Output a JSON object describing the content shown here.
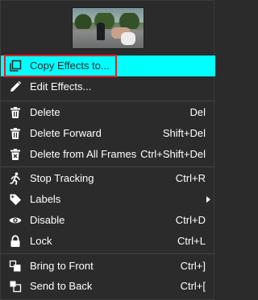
{
  "menu": {
    "items": {
      "copy_effects": {
        "label": "Copy Effects to...",
        "icon": "copy-icon"
      },
      "edit_effects": {
        "label": "Edit Effects...",
        "icon": "pencil-icon"
      },
      "delete": {
        "label": "Delete",
        "shortcut": "Del",
        "icon": "trash-icon"
      },
      "delete_forward": {
        "label": "Delete Forward",
        "shortcut": "Shift+Del",
        "icon": "trash-icon"
      },
      "delete_all_frames": {
        "label": "Delete from All Frames",
        "shortcut": "Ctrl+Shift+Del",
        "icon": "trash-frames-icon"
      },
      "stop_tracking": {
        "label": "Stop Tracking",
        "shortcut": "Ctrl+R",
        "icon": "running-person-icon"
      },
      "labels": {
        "label": "Labels",
        "icon": "tag-icon"
      },
      "disable": {
        "label": "Disable",
        "shortcut": "Ctrl+D",
        "icon": "eye-icon"
      },
      "lock": {
        "label": "Lock",
        "shortcut": "Ctrl+L",
        "icon": "lock-icon"
      },
      "bring_front": {
        "label": "Bring to Front",
        "shortcut": "Ctrl+]",
        "icon": "bring-front-icon"
      },
      "send_back": {
        "label": "Send to Back",
        "shortcut": "Ctrl+[",
        "icon": "send-back-icon"
      }
    }
  },
  "colors": {
    "background": "#2b2b2b",
    "highlight": "#00ffff",
    "annotation": "#e0212a"
  }
}
